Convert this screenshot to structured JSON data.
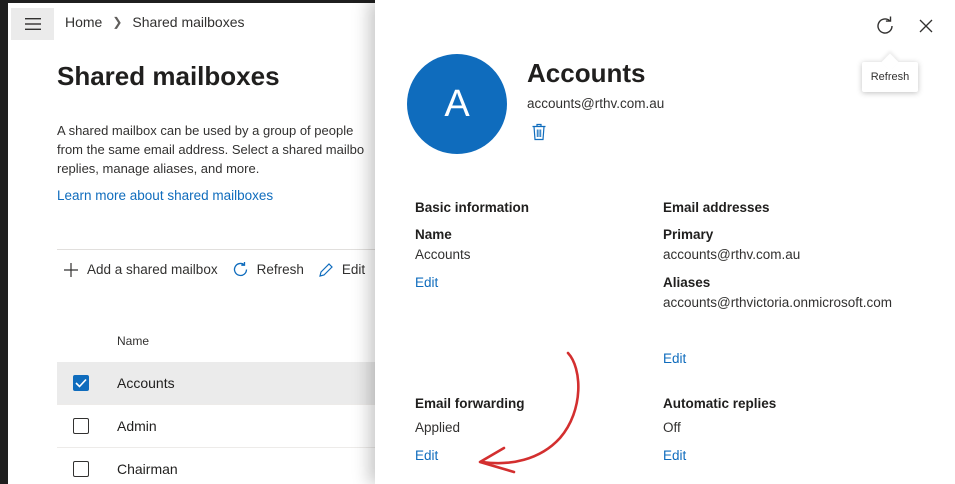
{
  "breadcrumb": {
    "home": "Home",
    "current": "Shared mailboxes"
  },
  "page": {
    "title": "Shared mailboxes",
    "description_lines": [
      "A shared mailbox can be used by a group of people",
      "from the same email address. Select a shared mailbo",
      "replies, manage aliases, and more."
    ],
    "learn_more": "Learn more about shared mailboxes"
  },
  "toolbar": {
    "add": "Add a shared mailbox",
    "refresh": "Refresh",
    "edit": "Edit"
  },
  "table": {
    "column_name": "Name",
    "rows": [
      {
        "label": "Accounts",
        "checked": true
      },
      {
        "label": "Admin",
        "checked": false
      },
      {
        "label": "Chairman",
        "checked": false
      }
    ]
  },
  "panel": {
    "avatar_letter": "A",
    "name": "Accounts",
    "email": "accounts@rthv.com.au",
    "tooltip": "Refresh",
    "basic_info": {
      "heading": "Basic information",
      "name_label": "Name",
      "name_value": "Accounts",
      "edit": "Edit"
    },
    "email_addresses": {
      "heading": "Email addresses",
      "primary_label": "Primary",
      "primary_value": "accounts@rthv.com.au",
      "aliases_label": "Aliases",
      "aliases_value": "accounts@rthvictoria.onmicrosoft.com",
      "edit": "Edit"
    },
    "email_forwarding": {
      "heading": "Email forwarding",
      "value": "Applied",
      "edit": "Edit"
    },
    "automatic_replies": {
      "heading": "Automatic replies",
      "value": "Off",
      "edit": "Edit"
    }
  },
  "colors": {
    "accent": "#0f6cbd",
    "annotation": "#d32f2f"
  }
}
